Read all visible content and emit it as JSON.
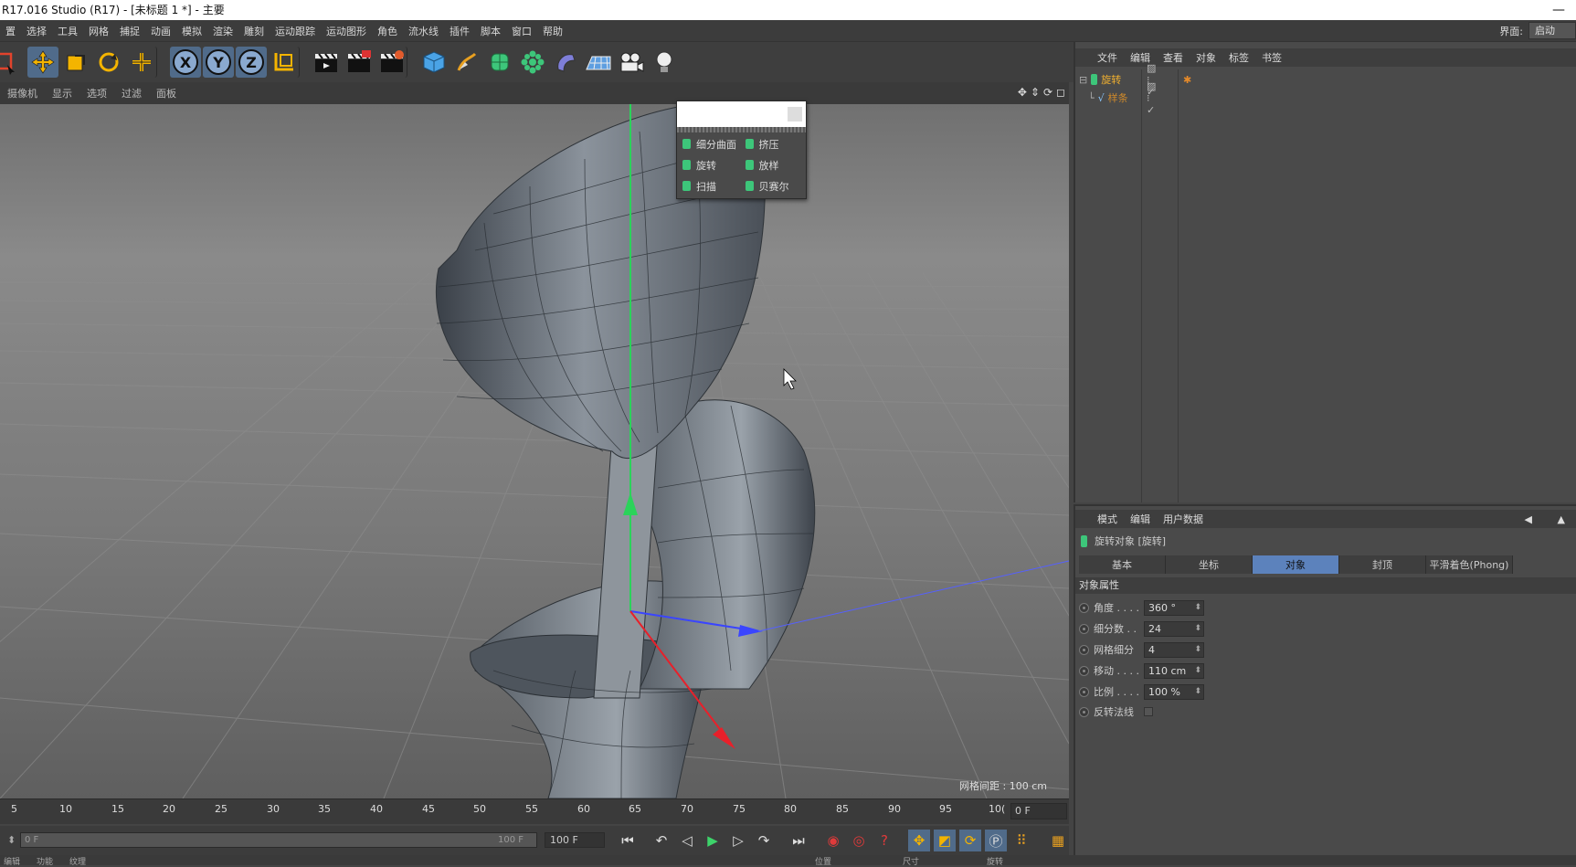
{
  "window": {
    "title": "R17.016 Studio (R17) - [未标题 1 *] - 主要",
    "minimize": "—"
  },
  "menubar": {
    "items": [
      "置",
      "选择",
      "工具",
      "网格",
      "捕捉",
      "动画",
      "模拟",
      "渲染",
      "雕刻",
      "运动跟踪",
      "运动图形",
      "角色",
      "流水线",
      "插件",
      "脚本",
      "窗口",
      "帮助"
    ],
    "layout_label": "界面:",
    "layout_value": "启动"
  },
  "toolbar": {
    "axis_x": "X",
    "axis_y": "Y",
    "axis_z": "Z"
  },
  "viewport": {
    "menus": [
      "摄像机",
      "显示",
      "选项",
      "过滤",
      "面板"
    ],
    "grid_info": "网格间距 : 100 cm"
  },
  "popup": {
    "items": [
      {
        "label": "细分曲面",
        "icon": "subdivision-surface-icon"
      },
      {
        "label": "挤压",
        "icon": "extrude-icon"
      },
      {
        "label": "旋转",
        "icon": "lathe-icon"
      },
      {
        "label": "放样",
        "icon": "loft-icon"
      },
      {
        "label": "扫描",
        "icon": "sweep-icon"
      },
      {
        "label": "贝赛尔",
        "icon": "bezier-icon"
      }
    ]
  },
  "object_manager": {
    "tabs": [
      "文件",
      "编辑",
      "查看",
      "对象",
      "标签",
      "书签"
    ],
    "objects": [
      {
        "name": "旋转",
        "color": "#f0b030"
      },
      {
        "name": "样条",
        "color": "#d08a2a"
      }
    ]
  },
  "attribute_manager": {
    "tabs": [
      "模式",
      "编辑",
      "用户数据"
    ],
    "object_title": "旋转对象 [旋转]",
    "subtabs": [
      "基本",
      "坐标",
      "对象",
      "封顶",
      "平滑着色(Phong)"
    ],
    "active_subtab": "对象",
    "section": "对象属性",
    "properties": [
      {
        "label": "角度 . . . .",
        "value": "360 °"
      },
      {
        "label": "细分数 . .",
        "value": "24"
      },
      {
        "label": "网格细分",
        "value": "4"
      },
      {
        "label": "移动 . . . .",
        "value": "110 cm"
      },
      {
        "label": "比例 . . . .",
        "value": "100 %"
      },
      {
        "label": "反转法线",
        "value": ""
      }
    ]
  },
  "timeline": {
    "ticks": [
      "5",
      "10",
      "15",
      "20",
      "25",
      "30",
      "35",
      "40",
      "45",
      "50",
      "55",
      "60",
      "65",
      "70",
      "75",
      "80",
      "85",
      "90",
      "95",
      "10("
    ],
    "current_frame": "0 F"
  },
  "playback": {
    "range_start": "0 F",
    "range_end": "100 F",
    "end_field": "100 F"
  },
  "bottom": {
    "labels": [
      "编辑",
      "功能",
      "纹理",
      "位置",
      "尺寸",
      "旋转"
    ]
  },
  "colors": {
    "accent": "#5c82bc",
    "panel": "#4a4a4a",
    "toolbar": "#3e3e3e"
  }
}
